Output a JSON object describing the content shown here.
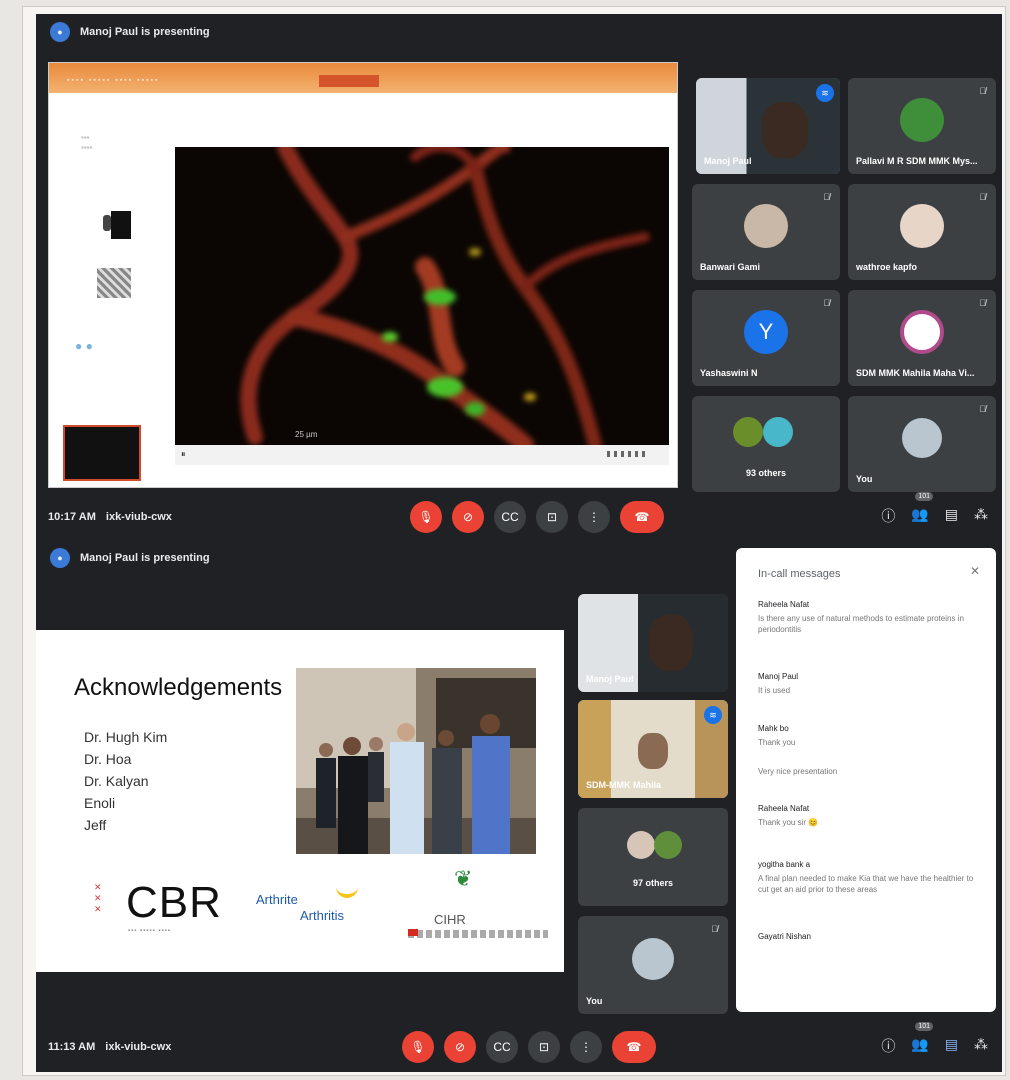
{
  "shot1": {
    "presenting_text": "Manoj Paul is presenting",
    "slide": {
      "scale_bar": "25 µm"
    },
    "tiles": [
      {
        "name": "Manoj Paul",
        "speaking": true
      },
      {
        "name": "Pallavi M R SDM MMK Mys..."
      },
      {
        "name": "Banwari Gami"
      },
      {
        "name": "wathroe kapfo"
      },
      {
        "name": "Yashaswini N",
        "initial": "Y"
      },
      {
        "name": "SDM MMK Mahila Maha Vi..."
      },
      {
        "name": "93 others"
      },
      {
        "name": "You"
      }
    ],
    "time": "10:17 AM",
    "meeting_code": "ixk-viub-cwx",
    "participants_badge": "101"
  },
  "shot2": {
    "presenting_text": "Manoj Paul is presenting",
    "slide": {
      "title": "Acknowledgements",
      "names": [
        "Dr. Hugh Kim",
        "Dr. Hoa",
        "Dr. Kalyan",
        "Enoli",
        "Jeff"
      ],
      "logo_cbr": "CBR",
      "logo_arthritis_1": "Arthrite",
      "logo_arthritis_2": "Arthritis",
      "logo_cihr": "CIHR"
    },
    "tiles": [
      {
        "name": "Manoj Paul"
      },
      {
        "name": "SDM-MMK Mahila",
        "speaking": true
      },
      {
        "name": "97 others"
      },
      {
        "name": "You"
      }
    ],
    "time": "11:13 AM",
    "meeting_code": "ixk-viub-cwx",
    "participants_badge": "101"
  },
  "chat": {
    "title": "In-call messages",
    "messages": [
      {
        "who": "Raheela Nafat",
        "text": "Is there any use of natural methods to estimate proteins in periodontitis"
      },
      {
        "who": "Manoj Paul",
        "text": "It is used"
      },
      {
        "who": "Mahk bo",
        "text": "Thank you"
      },
      {
        "who": "",
        "text": "Very nice presentation"
      },
      {
        "who": "Raheela Nafat",
        "text": "Thank you sir 😊"
      },
      {
        "who": "yogitha bank a",
        "text": "A final plan needed to make Kia that we have the healthier to cut get an aid prior to these areas"
      },
      {
        "who": "Gayatri Nishan",
        "text": ""
      }
    ]
  }
}
